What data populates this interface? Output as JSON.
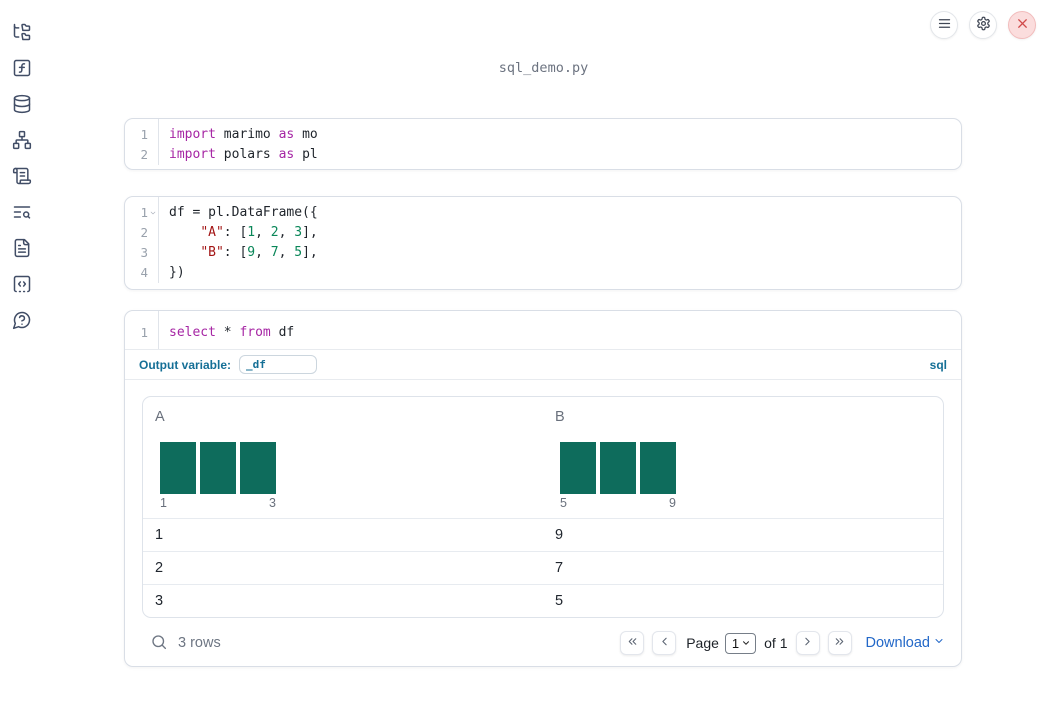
{
  "title": "sql_demo.py",
  "colors": {
    "keyword": "#a626a4",
    "string": "#a31515",
    "number": "#098658",
    "histogram_bar": "#0e6c5c",
    "sql_accent": "#156f96",
    "download_blue": "#2368c8",
    "close_red": "#d04b4b"
  },
  "sidebar": {
    "icons": [
      "file-tree",
      "function-square",
      "database",
      "network",
      "scroll-text",
      "list-search",
      "file-text",
      "code-square-dashed",
      "help-bubble"
    ]
  },
  "cells": [
    {
      "lines": [
        {
          "num": "1",
          "segments": [
            "import",
            " marimo ",
            "as",
            " mo"
          ]
        },
        {
          "num": "2",
          "segments": [
            "import",
            " polars ",
            "as",
            " pl"
          ]
        }
      ]
    },
    {
      "lines": [
        {
          "num": "1",
          "segments": [
            "df = pl.DataFrame({"
          ]
        },
        {
          "num": "2",
          "segments": [
            "    ",
            "\"A\"",
            ": [",
            "1",
            ", ",
            "2",
            ", ",
            "3",
            "],"
          ]
        },
        {
          "num": "3",
          "segments": [
            "    ",
            "\"B\"",
            ": [",
            "9",
            ", ",
            "7",
            ", ",
            "5",
            "],"
          ]
        },
        {
          "num": "4",
          "segments": [
            "})"
          ]
        }
      ]
    },
    {
      "lines": [
        {
          "num": "1",
          "segments": [
            "select",
            " * ",
            "from",
            " df"
          ]
        }
      ],
      "output_variable_label": "Output variable:",
      "output_variable_value": "_df",
      "language_badge": "sql"
    }
  ],
  "table": {
    "columns": [
      {
        "name": "A",
        "hist_bar_count": 3,
        "hist_min_label": "1",
        "hist_max_label": "3"
      },
      {
        "name": "B",
        "hist_bar_count": 3,
        "hist_min_label": "5",
        "hist_max_label": "9"
      }
    ],
    "rows": [
      [
        "1",
        "9"
      ],
      [
        "2",
        "7"
      ],
      [
        "3",
        "5"
      ]
    ],
    "row_count": "3 rows",
    "pagination": {
      "page_label": "Page",
      "current_page": "1",
      "total_label": "of 1"
    },
    "download_label": "Download"
  }
}
